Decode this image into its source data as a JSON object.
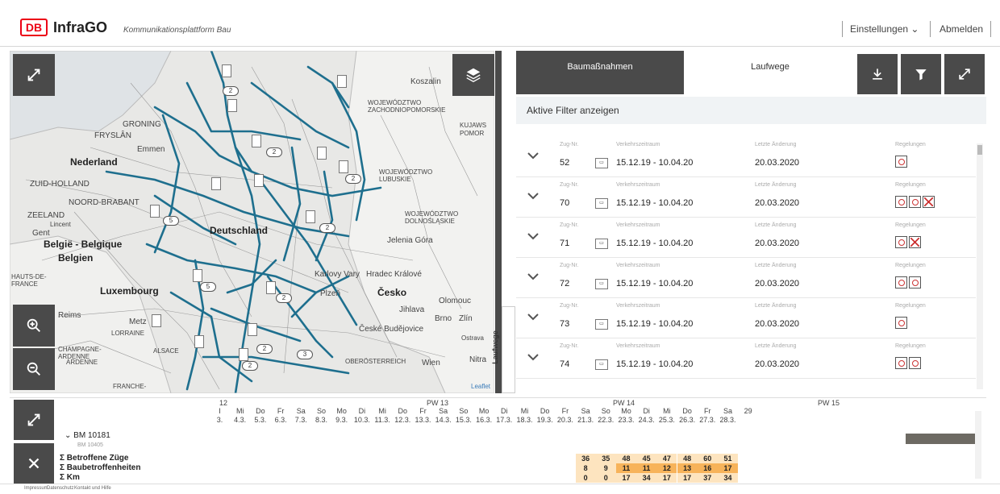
{
  "header": {
    "logo": "DB",
    "brand": "InfraGO",
    "subtitle": "Kommunikationsplattform Bau",
    "settings": "Einstellungen",
    "logout": "Abmelden"
  },
  "map": {
    "labels": [
      "Koszalin",
      "GRONING",
      "FRYSLÂN",
      "Emmen",
      "Nederland",
      "ZUID-HOLLAND",
      "NOORD-BRABANT",
      "ZEELAND",
      "Gent",
      "België - Belgique",
      "Belgien",
      "HAUTS-DE-FRANCE",
      "ARDENNE",
      "Luxembourg",
      "Reims",
      "Metz",
      "LORRAINE",
      "CHAMPAGNE-ARDENNE",
      "ALSACE",
      "FRANCHE-",
      "WOJEWÓDZTWO ZACHODNIOPOMORSKIE",
      "WOJEWÓDZTWO LUBUSKIE",
      "WOJEWÓDZTWO DOLNOŚLĄSKIE",
      "Deutschland",
      "Jelenia Góra",
      "Hradec Králové",
      "Karlovy Vary",
      "Plzeň",
      "Česko",
      "Olomouc",
      "Jihlava",
      "Brno",
      "Zlín",
      "České Budějovice",
      "OBERÖSTERREICH",
      "Wien",
      "Nitra",
      "Leaflet",
      "KUJAWS",
      "POMOR",
      "Ostrava",
      "Lincent"
    ],
    "clusters": [
      "2",
      "2",
      "5",
      "2",
      "2",
      "5",
      "2",
      "2",
      "3",
      "2"
    ]
  },
  "tabs": {
    "baumassnahmen": "Baumaßnahmen",
    "laufwege": "Laufwege",
    "side_tab": "Laufwege"
  },
  "filter_label": "Aktive Filter anzeigen",
  "columns": {
    "zug": "Zug-Nr.",
    "zeitraum": "Verkehrszeitraum",
    "aenderung": "Letzte Änderung",
    "regelungen": "Regelungen"
  },
  "rows": [
    {
      "zug": "52",
      "zeitraum": "15.12.19 - 10.04.20",
      "aenderung": "20.03.2020",
      "icons": [
        "clock"
      ]
    },
    {
      "zug": "70",
      "zeitraum": "15.12.19 - 10.04.20",
      "aenderung": "20.03.2020",
      "icons": [
        "clock",
        "clock",
        "star"
      ]
    },
    {
      "zug": "71",
      "zeitraum": "15.12.19 - 10.04.20",
      "aenderung": "20.03.2020",
      "icons": [
        "clock",
        "star"
      ]
    },
    {
      "zug": "72",
      "zeitraum": "15.12.19 - 10.04.20",
      "aenderung": "20.03.2020",
      "icons": [
        "clock",
        "clock"
      ]
    },
    {
      "zug": "73",
      "zeitraum": "15.12.19 - 10.04.20",
      "aenderung": "20.03.2020",
      "icons": [
        "clock"
      ]
    },
    {
      "zug": "74",
      "zeitraum": "15.12.19 - 10.04.20",
      "aenderung": "20.03.2020",
      "icons": [
        "clock",
        "clock"
      ]
    }
  ],
  "timeline": {
    "weeks": [
      "12",
      "PW 13",
      "PW 14",
      "PW 15"
    ],
    "days": [
      {
        "d": "I",
        "dt": "3."
      },
      {
        "d": "Mi",
        "dt": "4.3."
      },
      {
        "d": "Do",
        "dt": "5.3."
      },
      {
        "d": "Fr",
        "dt": "6.3."
      },
      {
        "d": "Sa",
        "dt": "7.3."
      },
      {
        "d": "So",
        "dt": "8.3."
      },
      {
        "d": "Mo",
        "dt": "9.3."
      },
      {
        "d": "Di",
        "dt": "10.3."
      },
      {
        "d": "Mi",
        "dt": "11.3."
      },
      {
        "d": "Do",
        "dt": "12.3."
      },
      {
        "d": "Fr",
        "dt": "13.3."
      },
      {
        "d": "Sa",
        "dt": "14.3."
      },
      {
        "d": "So",
        "dt": "15.3."
      },
      {
        "d": "Mo",
        "dt": "16.3."
      },
      {
        "d": "Di",
        "dt": "17.3."
      },
      {
        "d": "Mi",
        "dt": "18.3."
      },
      {
        "d": "Do",
        "dt": "19.3."
      },
      {
        "d": "Fr",
        "dt": "20.3."
      },
      {
        "d": "Sa",
        "dt": "21.3."
      },
      {
        "d": "So",
        "dt": "22.3."
      },
      {
        "d": "Mo",
        "dt": "23.3."
      },
      {
        "d": "Di",
        "dt": "24.3."
      },
      {
        "d": "Mi",
        "dt": "25.3."
      },
      {
        "d": "Do",
        "dt": "26.3."
      },
      {
        "d": "Fr",
        "dt": "27.3."
      },
      {
        "d": "Sa",
        "dt": "28.3."
      },
      {
        "d": "",
        "dt": "29"
      }
    ],
    "bm1": "BM 10181",
    "bm2": "BM 10405",
    "sum_rows": [
      {
        "label": "Betroffene Züge",
        "values": [
          "36",
          "35",
          "48",
          "45",
          "47",
          "48",
          "60",
          "51"
        ]
      },
      {
        "label": "Baubetroffenheiten",
        "values": [
          "8",
          "9",
          "11",
          "11",
          "12",
          "13",
          "16",
          "17"
        ]
      },
      {
        "label": "Km",
        "values": [
          "0",
          "0",
          "17",
          "34",
          "17",
          "17",
          "37",
          "34"
        ]
      }
    ]
  },
  "footer": {
    "impressum": "Impressum",
    "datenschutz": "Datenschutz",
    "kontakt": "Kontakt und Hilfe"
  },
  "colors": {
    "db_red": "#ec0016",
    "dark_button": "#4a4a4a",
    "railway": "#1e6f8e",
    "highlight_light": "#fde4bf",
    "highlight_dark": "#f7b35a"
  }
}
